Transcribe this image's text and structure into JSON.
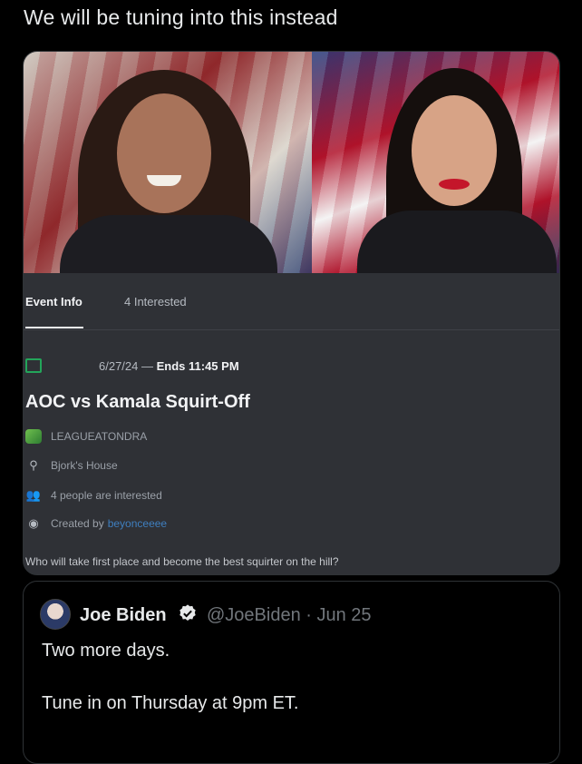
{
  "tweet": {
    "text": "We will be tuning into this instead"
  },
  "event_card": {
    "tabs": [
      {
        "label": "Event Info"
      },
      {
        "label": "4 Interested"
      }
    ],
    "date_start": "6/27/24",
    "date_separator": " — ",
    "date_end": "Ends 11:45 PM",
    "title": "AOC vs Kamala Squirt-Off",
    "server_name": "LEAGUEATONDRA",
    "location": "Bjork's House",
    "interested_text": "4 people are interested",
    "created_by_prefix": "Created by",
    "creator": "beyonceeee",
    "description": "Who will take first place and become the best squirter on the hill?",
    "colors": {
      "panel": "#2f3136",
      "calendar_icon": "#23a55a",
      "creator_link": "#3f7fbf"
    }
  },
  "quoted_tweet": {
    "display_name": "Joe Biden",
    "handle_and_date": "@JoeBiden · Jun 25",
    "line1": "Two more days.",
    "line2": "Tune in on Thursday at 9pm ET.",
    "verified_color": "#e7e9ea"
  },
  "icons": [
    "calendar-icon",
    "server-icon",
    "location-pin-icon",
    "people-icon",
    "creator-avatar-icon",
    "verified-badge-icon",
    "avatar"
  ]
}
